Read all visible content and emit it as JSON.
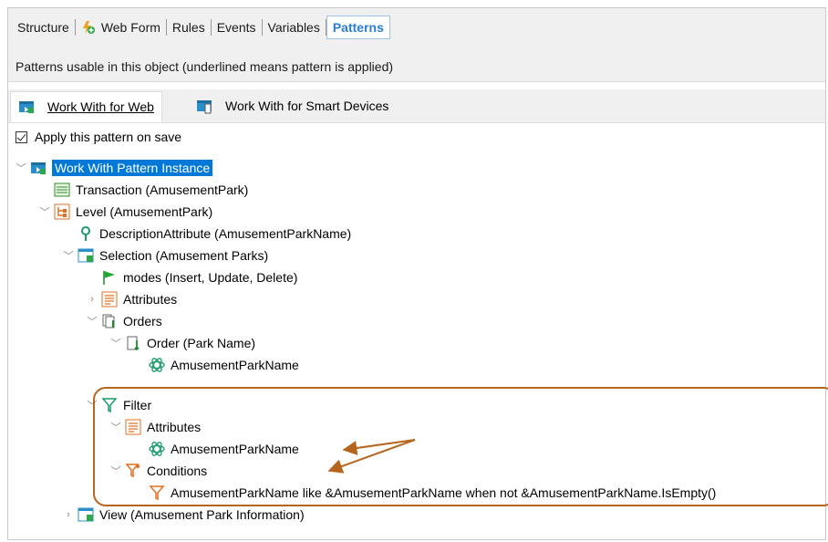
{
  "tabs": [
    {
      "label": "Structure"
    },
    {
      "label": "Web Form"
    },
    {
      "label": "Rules"
    },
    {
      "label": "Events"
    },
    {
      "label": "Variables"
    },
    {
      "label": "Patterns"
    }
  ],
  "info_text": "Patterns usable in this object (underlined means pattern is applied)",
  "subtabs": [
    {
      "label": "Work With for Web"
    },
    {
      "label": "Work With for Smart Devices"
    }
  ],
  "apply_label": "Apply this pattern on save",
  "tree": {
    "root": "Work With Pattern Instance",
    "transaction": "Transaction (AmusementPark)",
    "level": "Level (AmusementPark)",
    "description_attr": "DescriptionAttribute (AmusementParkName)",
    "selection": "Selection (Amusement Parks)",
    "modes": "modes (Insert, Update, Delete)",
    "attributes": "Attributes",
    "orders": "Orders",
    "order": "Order (Park Name)",
    "order_attr": "AmusementParkName",
    "filter": "Filter",
    "filter_attributes": "Attributes",
    "filter_attr": "AmusementParkName",
    "conditions": "Conditions",
    "condition": "AmusementParkName like &AmusementParkName when  not &AmusementParkName.IsEmpty()",
    "view": "View (Amusement Park Information)"
  },
  "colors": {
    "accent": "#b5651d",
    "selection": "#0078d7",
    "tab_active": "#2a7fd4"
  }
}
